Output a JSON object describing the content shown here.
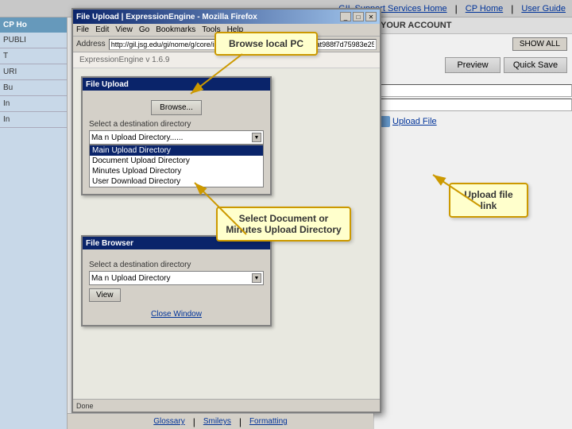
{
  "browser": {
    "title": "File Upload | ExpressionEngine - Mozilla Firefox",
    "menu_items": [
      "File",
      "Edit",
      "View",
      "Go",
      "Bookmarks",
      "Tools",
      "Help"
    ],
    "address": "http://gil.jsg.edu/gi/nome/g/core/index.php?S=9dCdc8c965a856cat988f7d75983e25",
    "status": "Done"
  },
  "top_nav": {
    "links": [
      "GIL Support Services Home",
      "CP Home",
      "User Guide"
    ]
  },
  "ee_header": {
    "text": "ExpressionEngine v 1.6.9"
  },
  "right_panel": {
    "account_header": "YOUR ACCOUNT",
    "preview_btn": "Preview",
    "quicksave_btn": "Quick Save",
    "upload_file_link": "Upload File",
    "show_all_btn": "SHOW ALL",
    "glossary_link": "Glossary",
    "smileys_link": "Smileys",
    "formatting_link": "Formatting"
  },
  "left_sidebar": {
    "header": "CP Ho",
    "sections": [
      "PUBLI",
      "T",
      "URI",
      "Bu",
      "In",
      "In"
    ]
  },
  "file_upload_panel": {
    "title": "File Upload",
    "browse_btn": "Browse...",
    "select_label": "Select a destination directory",
    "dropdown_selected": "Ma n Upload Directory......",
    "dropdown_items": [
      {
        "label": "Main Upload Directory",
        "selected": true
      },
      {
        "label": "Document Upload Directory",
        "selected": false
      },
      {
        "label": "Minutes Upload Directory",
        "selected": false
      },
      {
        "label": "User Download Directory",
        "selected": false
      }
    ]
  },
  "file_browser_panel": {
    "title": "File Browser",
    "select_label": "Select a destination directory",
    "dropdown_selected": "Ma n Upload Directory",
    "view_btn": "View",
    "close_window": "Close Window"
  },
  "callouts": {
    "browse_local": "Browse local PC",
    "select_directory": "Select Document or\nMinutes Upload Directory",
    "upload_file_link": "Upload file\nlink"
  },
  "arrows": {
    "browse_arrow": "points to Browse button",
    "select_arrow": "points to dropdown list",
    "upload_arrow": "points to Upload File link"
  }
}
